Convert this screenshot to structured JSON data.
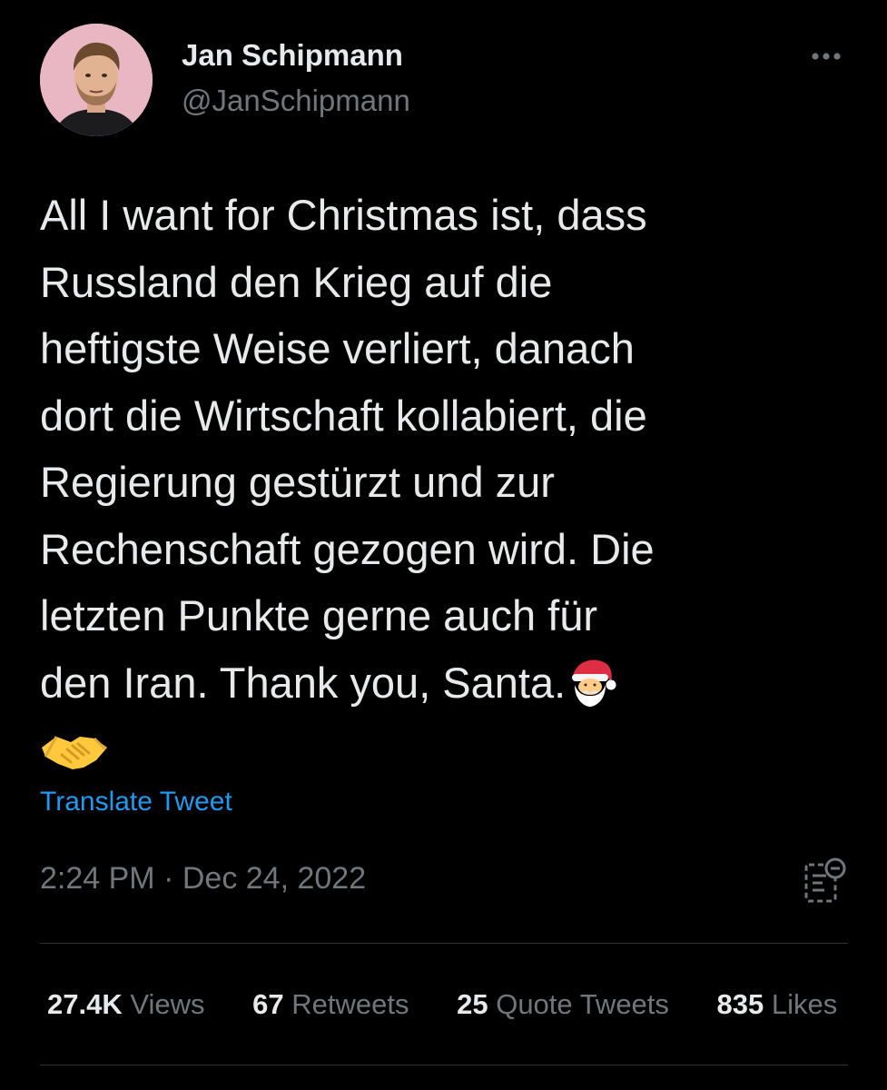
{
  "author": {
    "name": "Jan Schipmann",
    "handle": "@JanSchipmann",
    "avatar_bg": "#e9b7c4"
  },
  "more_icon": "more-horizontal-icon",
  "tweet": {
    "lines": [
      "All I want for Christmas ist, dass",
      "Russland den Krieg auf die",
      "heftigste Weise verliert, danach",
      "dort die Wirtschaft kollabiert, die",
      "Regierung gestürzt und zur",
      "Rechenschaft gezogen wird. Die",
      "letzten Punkte gerne auch für",
      "den Iran. Thank you, Santa."
    ],
    "emojis": [
      "santa-emoji",
      "handshake-emoji"
    ]
  },
  "translate_label": "Translate Tweet",
  "meta": {
    "time": "2:24 PM",
    "separator": "·",
    "date": "Dec 24, 2022"
  },
  "analytics_icon": "analytics-icon",
  "stats": [
    {
      "count": "27.4K",
      "label": "Views"
    },
    {
      "count": "67",
      "label": "Retweets"
    },
    {
      "count": "25",
      "label": "Quote Tweets"
    },
    {
      "count": "835",
      "label": "Likes"
    }
  ],
  "colors": {
    "background": "#000000",
    "text": "#e7e9ea",
    "secondary": "#71767b",
    "link": "#1d9bf0",
    "divider": "#2f3336"
  }
}
